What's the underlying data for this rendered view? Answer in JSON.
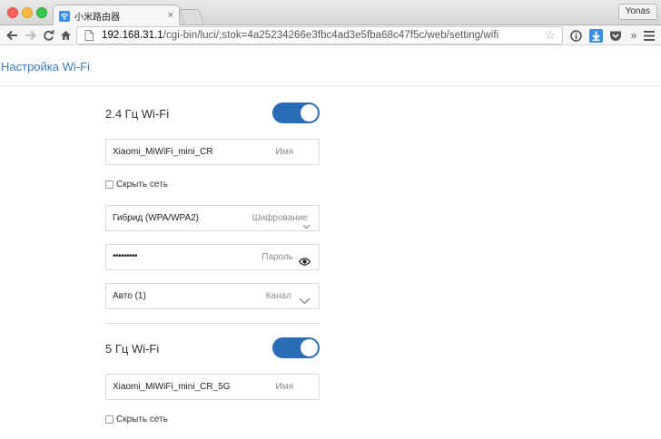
{
  "browser": {
    "tab_title": "小米路由器",
    "tab_close": "×",
    "profile_name": "Yonas",
    "url_host": "192.168.31.1",
    "url_path": "/cgi-bin/luci/;stok=4a25234266e3fbc4ad3e5fba68c47f5c/web/setting/wifi",
    "overflow_label": "»"
  },
  "page": {
    "title": "Настройка Wi-Fi"
  },
  "wifi_24": {
    "title": "2.4 Гц Wi-Fi",
    "enabled": true,
    "ssid_value": "Xiaomi_MiWiFi_mini_CR",
    "ssid_hint": "Имя",
    "hide_label": "Скрыть сеть",
    "hidden": false,
    "encryption_value": "Гибрид (WPA/WPA2)",
    "encryption_hint": "Шифрование",
    "password_value": "•••••••••",
    "password_hint": "Пароль",
    "channel_value": "Авто (1)",
    "channel_hint": "Канал"
  },
  "wifi_5": {
    "title": "5 Гц Wi-Fi",
    "enabled": true,
    "ssid_value": "Xiaomi_MiWiFi_mini_CR_5G",
    "ssid_hint": "Имя",
    "hide_label": "Скрыть сеть",
    "hidden": false
  },
  "colors": {
    "accent": "#2b6cb6",
    "title_blue": "#3b7bbf"
  }
}
